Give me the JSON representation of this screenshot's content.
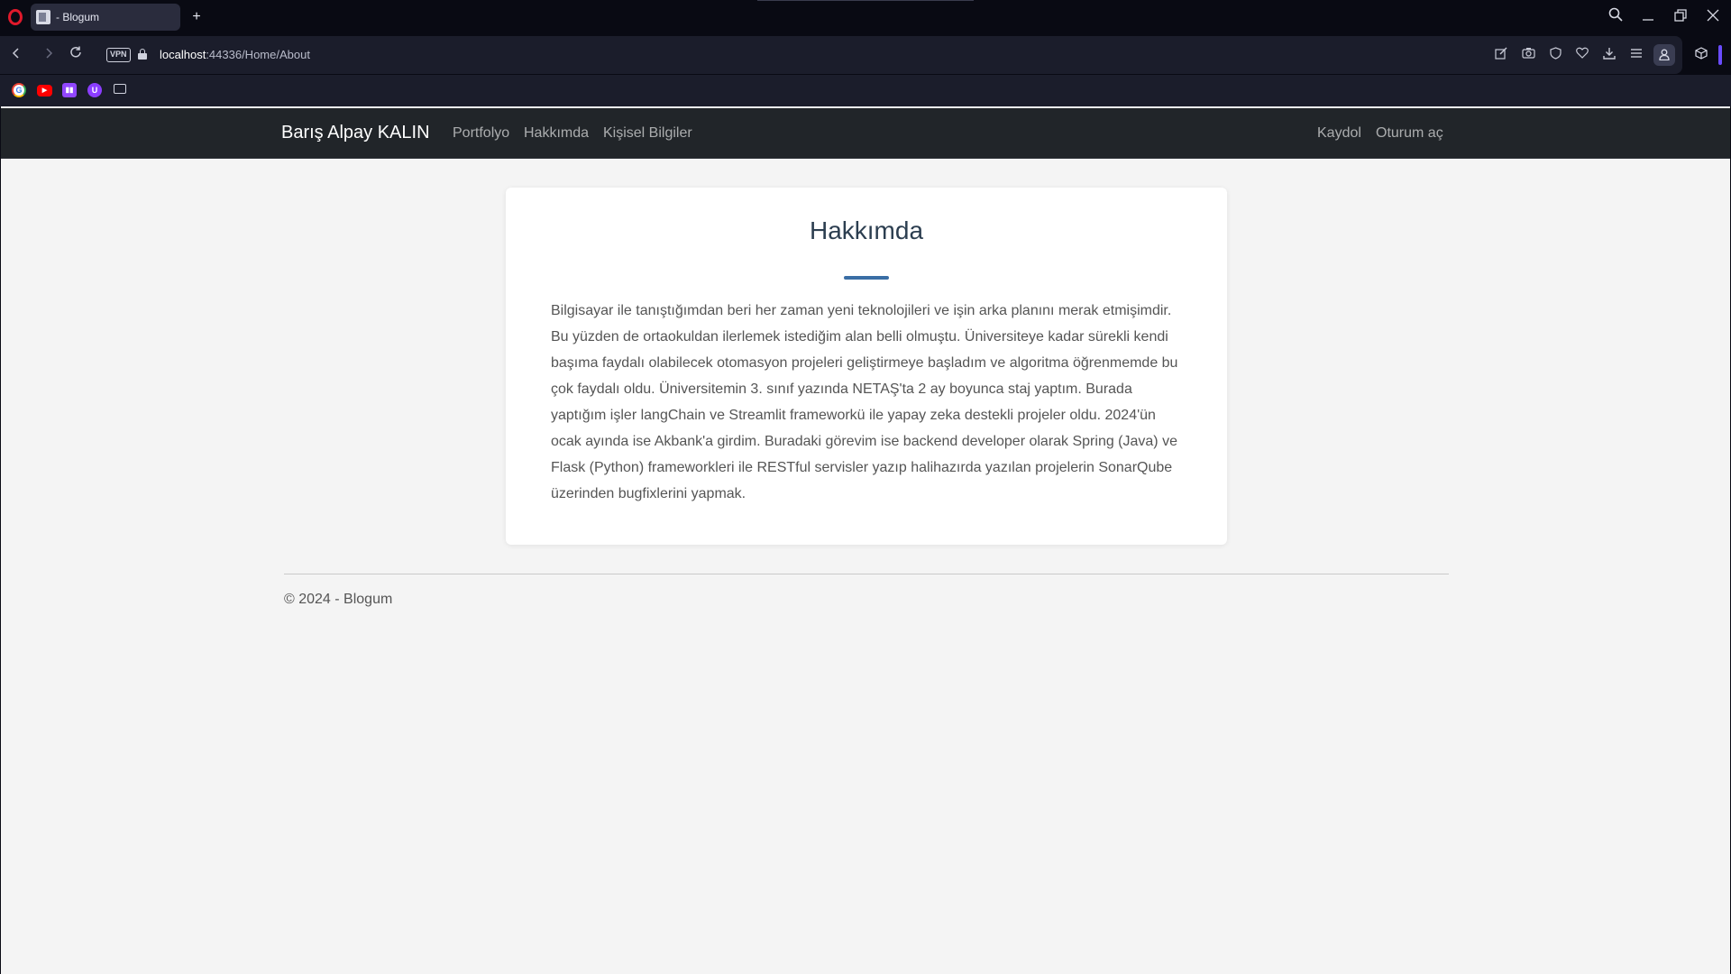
{
  "browser": {
    "tab_title": "- Blogum",
    "new_tab_symbol": "+",
    "url_host": "localhost",
    "url_path": ":44336/Home/About",
    "vpn_label": "VPN",
    "icons": {
      "back": "back-arrow-icon",
      "forward": "forward-arrow-icon",
      "reload": "reload-icon",
      "search": "search-icon",
      "minimize": "minimize-icon",
      "restore": "restore-icon",
      "close": "close-icon",
      "lock": "lock-icon",
      "edit": "edit-icon",
      "camera": "camera-icon",
      "shield": "shield-icon",
      "heart": "heart-icon",
      "download": "download-icon",
      "menu": "easy-setup-icon",
      "profile": "profile-icon",
      "extensions": "extensions-icon"
    },
    "bookmarks": [
      "google-icon",
      "youtube-icon",
      "twitch-icon",
      "u-icon",
      "folder-icon"
    ],
    "accent_color": "#6a4cff"
  },
  "site": {
    "brand": "Barış Alpay KALIN",
    "nav_links": [
      "Portfolyo",
      "Hakkımda",
      "Kişisel Bilgiler"
    ],
    "nav_right": [
      "Kaydol",
      "Oturum aç"
    ],
    "nav_bg": "#212529"
  },
  "about": {
    "title": "Hakkımda",
    "body": "Bilgisayar ile tanıştığımdan beri her zaman yeni teknolojileri ve işin arka planını merak etmişimdir. Bu yüzden de ortaokuldan ilerlemek istediğim alan belli olmuştu. Üniversiteye kadar sürekli kendi başıma faydalı olabilecek otomasyon projeleri geliştirmeye başladım ve algoritma öğrenmemde bu çok faydalı oldu. Üniversitemin 3. sınıf yazında NETAŞ'ta 2 ay boyunca staj yaptım. Burada yaptığım işler langChain ve Streamlit frameworkü ile yapay zeka destekli projeler oldu. 2024'ün ocak ayında ise Akbank'a girdim. Buradaki görevim ise backend developer olarak Spring (Java) ve Flask (Python) frameworkleri ile RESTful servisler yazıp halihazırda yazılan projelerin SonarQube üzerinden bugfixlerini yapmak.",
    "accent_color": "#3a6ea5"
  },
  "footer": {
    "text": "© 2024 - Blogum"
  }
}
